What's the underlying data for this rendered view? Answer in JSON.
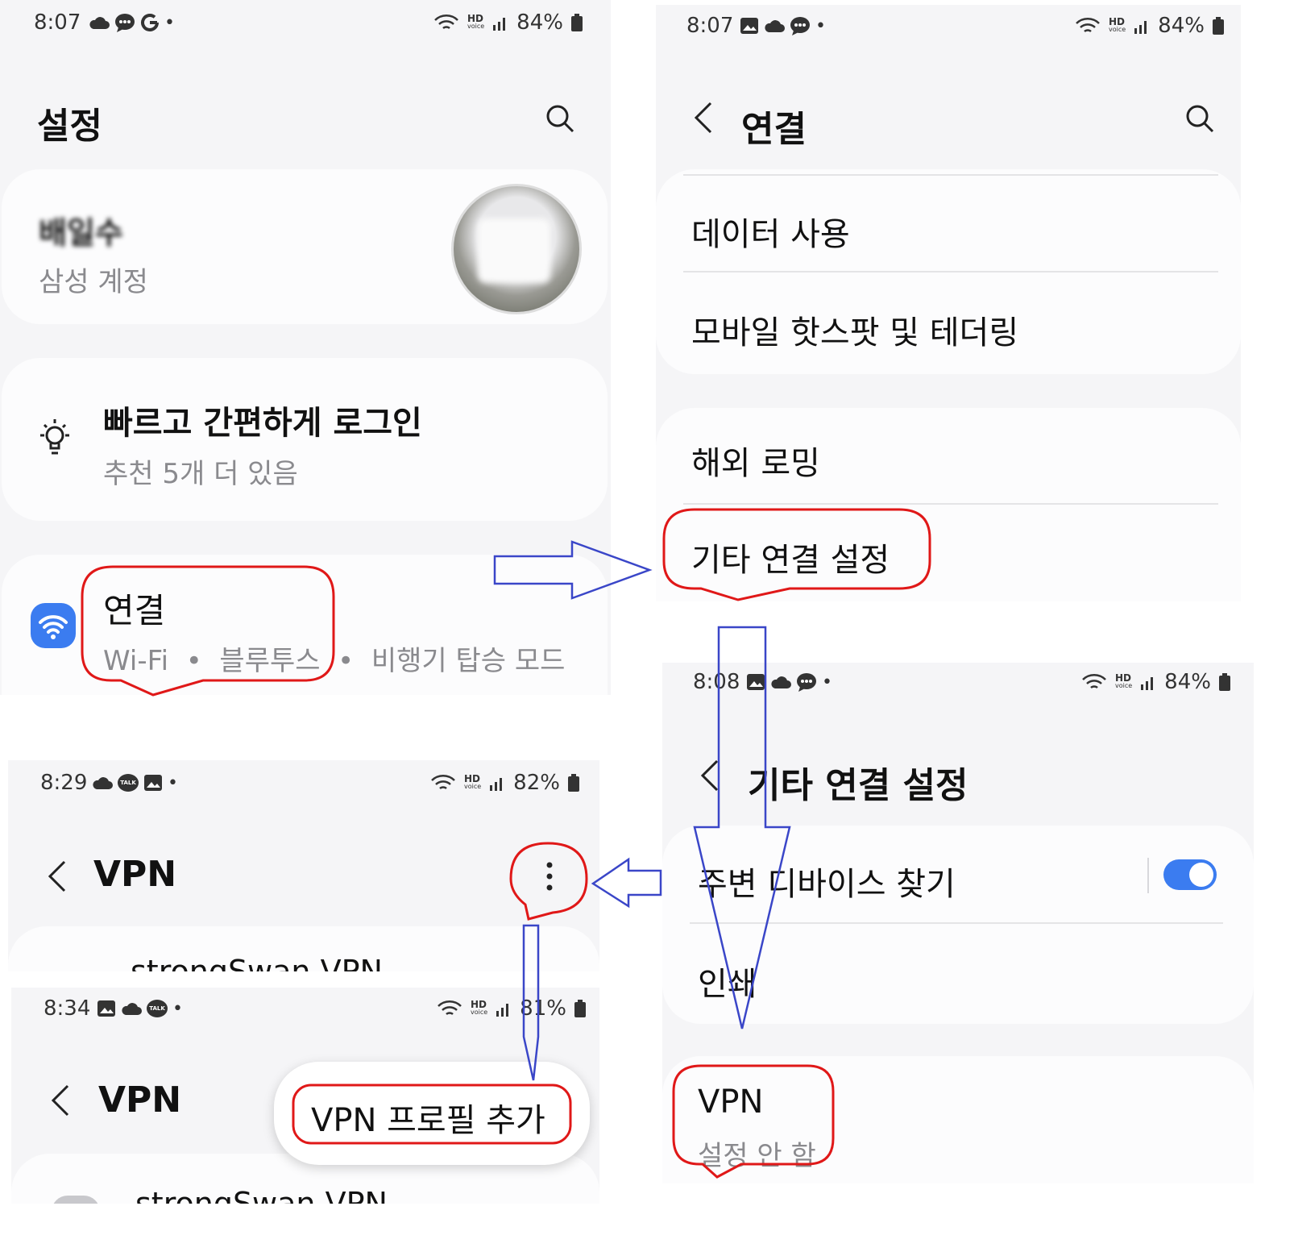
{
  "panel_settings": {
    "status": {
      "time": "8:07",
      "battery": "84%"
    },
    "title": "설정",
    "account": {
      "name": "배일수",
      "sub": "삼성 계정"
    },
    "quick_login": {
      "title": "빠르고 간편하게 로그인",
      "sub": "추천 5개 더 있음"
    },
    "connections": {
      "title": "연결",
      "sub_items": [
        "Wi-Fi",
        "블루투스",
        "비행기 탑승 모드"
      ]
    }
  },
  "panel_connections": {
    "status": {
      "time": "8:07",
      "battery": "84%"
    },
    "title": "연결",
    "items": [
      "데이터 사용",
      "모바일 핫스팟 및 테더링",
      "해외 로밍",
      "기타 연결 설정"
    ]
  },
  "panel_more": {
    "status": {
      "time": "8:08",
      "battery": "84%"
    },
    "title": "기타 연결 설정",
    "items": [
      "주변 디바이스 찾기",
      "인쇄"
    ],
    "vpn": {
      "title": "VPN",
      "sub": "설정 안 함"
    }
  },
  "panel_vpn": {
    "status": {
      "time": "8:29",
      "battery": "82%"
    },
    "title": "VPN",
    "item": "strongSwan VPN"
  },
  "panel_vpn_add": {
    "status": {
      "time": "8:34",
      "battery": "81%"
    },
    "title": "VPN",
    "menu_item": "VPN 프로필 추가",
    "item": "strongSwan VPN"
  },
  "status_labels": {
    "hd": "HD",
    "voice": "voice",
    "talk": "TALK"
  },
  "colors": {
    "highlight": "#e01818",
    "arrow": "#3a46c8",
    "accent": "#3b7cf0"
  }
}
